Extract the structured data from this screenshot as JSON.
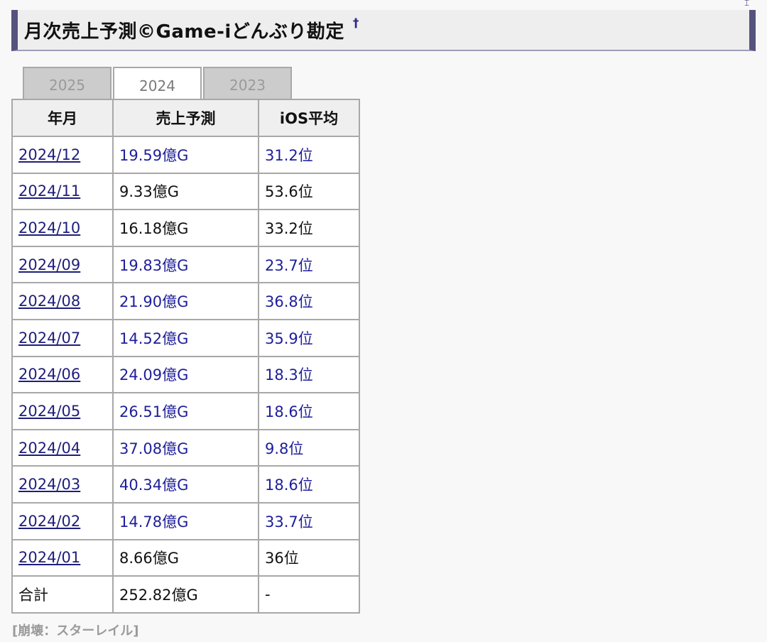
{
  "corner_mark": "⌶",
  "heading": {
    "title": "月次売上予測©Game-iどんぶり勘定",
    "anchor": "†"
  },
  "tabs": [
    {
      "label": "2025",
      "active": false
    },
    {
      "label": "2024",
      "active": true
    },
    {
      "label": "2023",
      "active": false
    }
  ],
  "table": {
    "headers": [
      "年月",
      "売上予測",
      "iOS平均"
    ],
    "rows": [
      {
        "month": "2024/12",
        "sales": "19.59億G",
        "ios": "31.2位",
        "sales_color": "blue",
        "ios_color": "blue"
      },
      {
        "month": "2024/11",
        "sales": "9.33億G",
        "ios": "53.6位",
        "sales_color": "black",
        "ios_color": "black"
      },
      {
        "month": "2024/10",
        "sales": "16.18億G",
        "ios": "33.2位",
        "sales_color": "black",
        "ios_color": "black"
      },
      {
        "month": "2024/09",
        "sales": "19.83億G",
        "ios": "23.7位",
        "sales_color": "blue",
        "ios_color": "blue"
      },
      {
        "month": "2024/08",
        "sales": "21.90億G",
        "ios": "36.8位",
        "sales_color": "blue",
        "ios_color": "blue"
      },
      {
        "month": "2024/07",
        "sales": "14.52億G",
        "ios": "35.9位",
        "sales_color": "blue",
        "ios_color": "blue"
      },
      {
        "month": "2024/06",
        "sales": "24.09億G",
        "ios": "18.3位",
        "sales_color": "blue",
        "ios_color": "blue"
      },
      {
        "month": "2024/05",
        "sales": "26.51億G",
        "ios": "18.6位",
        "sales_color": "blue",
        "ios_color": "blue"
      },
      {
        "month": "2024/04",
        "sales": "37.08億G",
        "ios": "9.8位",
        "sales_color": "blue",
        "ios_color": "blue"
      },
      {
        "month": "2024/03",
        "sales": "40.34億G",
        "ios": "18.6位",
        "sales_color": "blue",
        "ios_color": "blue"
      },
      {
        "month": "2024/02",
        "sales": "14.78億G",
        "ios": "33.7位",
        "sales_color": "blue",
        "ios_color": "blue"
      },
      {
        "month": "2024/01",
        "sales": "8.66億G",
        "ios": "36位",
        "sales_color": "black",
        "ios_color": "black"
      }
    ],
    "total": {
      "label": "合計",
      "sales": "252.82億G",
      "ios": "-"
    }
  },
  "footer_tag": "[崩壊：スターレイル]",
  "colors": {
    "heading_bar": "#55527e",
    "link": "#1e1e7a",
    "blue_value": "#1e1e9a",
    "tab_inactive_bg": "#cccccc",
    "tab_active_bg": "#ffffff"
  }
}
